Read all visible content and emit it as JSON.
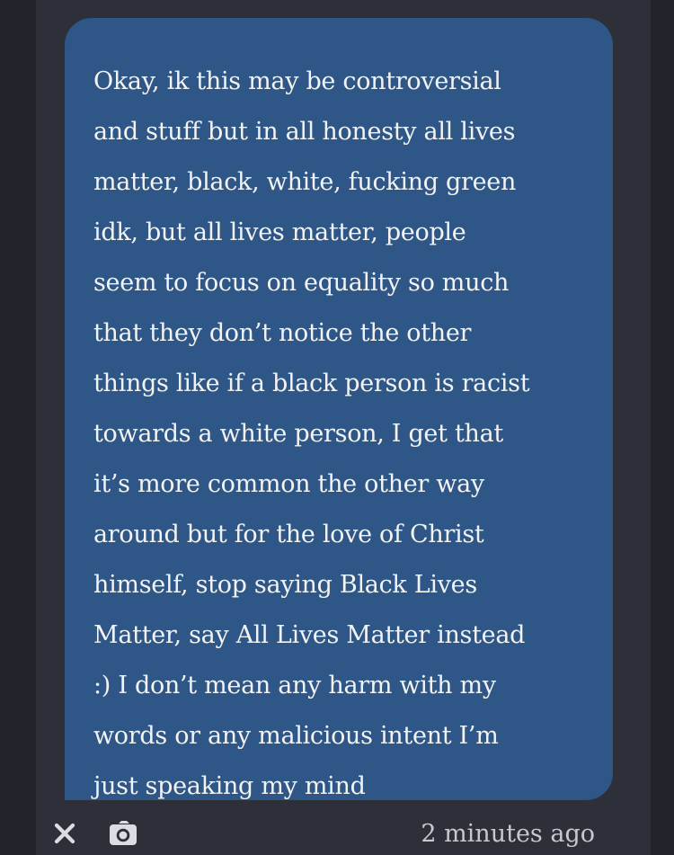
{
  "message": {
    "text": "Okay, ik this may be controversial\nand stuff but in all honesty all lives\nmatter, black, white, fucking green\nidk, but all lives matter, people\nseem to focus on equality so much\nthat they don’t notice the other\nthings like if a black person is racist\ntowards a white person, I get that\nit’s more common the other way\naround but for the love of Christ\nhimself, stop saying Black Lives\nMatter, say All Lives Matter instead\n:) I don’t mean any harm with my\nwords or any malicious intent I’m\njust speaking my mind"
  },
  "footer": {
    "timestamp": "2 minutes ago",
    "icons": [
      "close-icon",
      "camera-icon"
    ]
  },
  "colors": {
    "background": "#2e3039",
    "bubble": "#2e5687",
    "text": "#f3f3f3",
    "muted": "#c8c9cf"
  }
}
